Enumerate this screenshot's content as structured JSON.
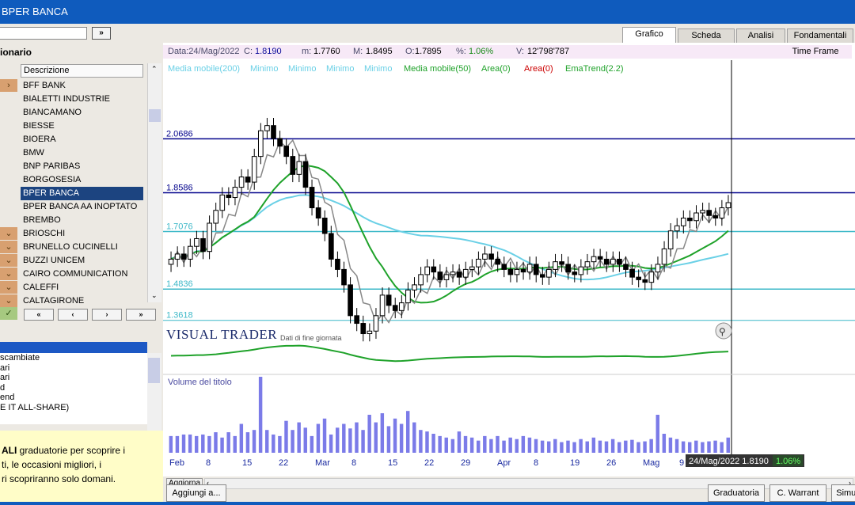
{
  "window": {
    "title": "BPER BANCA"
  },
  "left": {
    "search_value": "",
    "go_label": "»",
    "list_label": "ionario",
    "list_header": "Descrizione",
    "items": [
      {
        "label": "BFF BANK",
        "icon": "chevron-right-icon"
      },
      {
        "label": "BIALETTI INDUSTRIE",
        "icon": ""
      },
      {
        "label": "BIANCAMANO",
        "icon": ""
      },
      {
        "label": "BIESSE",
        "icon": ""
      },
      {
        "label": "BIOERA",
        "icon": ""
      },
      {
        "label": "BMW",
        "icon": ""
      },
      {
        "label": "BNP PARIBAS",
        "icon": ""
      },
      {
        "label": "BORGOSESIA",
        "icon": ""
      },
      {
        "label": "BPER BANCA",
        "icon": "",
        "selected": true
      },
      {
        "label": "BPER BANCA AA INOPTATO",
        "icon": ""
      },
      {
        "label": "BREMBO",
        "icon": ""
      },
      {
        "label": "BRIOSCHI",
        "icon": "chevron-down-icon"
      },
      {
        "label": "BRUNELLO CUCINELLI",
        "icon": "chevron-down-icon"
      },
      {
        "label": "BUZZI UNICEM",
        "icon": "chevron-down-icon"
      },
      {
        "label": "CAIRO COMMUNICATION",
        "icon": "chevron-down-icon"
      },
      {
        "label": "CALEFFI",
        "icon": "chevron-down-icon"
      },
      {
        "label": "CALTAGIRONE",
        "icon": "chevron-down-icon"
      }
    ],
    "nav": [
      "«",
      "‹",
      "›",
      "»"
    ],
    "info_lines": [
      "scambiate",
      "ari",
      "ari",
      "d",
      "end",
      "E IT ALL-SHARE)"
    ],
    "promo_bold": "ALI",
    "promo_lines": [
      " graduatorie per scoprire i",
      "ti, le occasioni migliori, i",
      "ri scopriranno solo domani."
    ]
  },
  "tabs": [
    {
      "label": "Grafico",
      "active": true
    },
    {
      "label": "Scheda",
      "active": false
    },
    {
      "label": "Analisi",
      "active": false
    },
    {
      "label": "Fondamentali",
      "active": false
    }
  ],
  "databar": {
    "date": "Data:24/Mag/2022",
    "close_label": "C:",
    "close": "1.8190",
    "min_label": "m:",
    "min": "1.7760",
    "max_label": "M:",
    "max": "1.8495",
    "open_label": "O:",
    "open": "1.7895",
    "pct_label": "%:",
    "pct": "1.06%",
    "vol_label": "V:",
    "vol": "12'798'787",
    "timeframe": "Time Frame"
  },
  "legend": [
    {
      "label": "Media mobile(200)",
      "color": "#6ad0e6"
    },
    {
      "label": "Minimo",
      "color": "#6ad0e6"
    },
    {
      "label": "Minimo",
      "color": "#6ad0e6"
    },
    {
      "label": "Minimo",
      "color": "#6ad0e6"
    },
    {
      "label": "Minimo",
      "color": "#6ad0e6"
    },
    {
      "label": "Media mobile(50)",
      "color": "#1fa22a"
    },
    {
      "label": "Area(0)",
      "color": "#1fa22a"
    },
    {
      "label": "Area(0)",
      "color": "#cc0000"
    },
    {
      "label": "EmaTrend(2.2)",
      "color": "#1fa22a"
    }
  ],
  "levels": [
    "2.0686",
    "1.8586",
    "1.7076",
    "1.4836",
    "1.3618"
  ],
  "brand": "VISUAL TRADER",
  "brand_sub": "Dati di fine giornata",
  "volume_label": "Volume del titolo",
  "x_labels": [
    "Feb",
    "8",
    "15",
    "22",
    "Mar",
    "8",
    "15",
    "22",
    "29",
    "Apr",
    "8",
    "19",
    "26",
    "Mag",
    "9"
  ],
  "cursor_tag": {
    "text": "24/Mag/2022 1.8190",
    "pct": "1.06%"
  },
  "buttons": {
    "aggiorna": "Aggiorna",
    "aggiungi": "Aggiungi a...",
    "graduatoria": "Graduatoria",
    "cwarrant": "C. Warrant",
    "simul": "Simul"
  },
  "chart_data": {
    "type": "candlestick",
    "closes": [
      1.6,
      1.62,
      1.6,
      1.65,
      1.68,
      1.63,
      1.74,
      1.79,
      1.85,
      1.84,
      1.88,
      1.92,
      1.9,
      2.0,
      2.1,
      2.12,
      2.07,
      2.04,
      2.0,
      1.93,
      1.98,
      1.88,
      1.8,
      1.76,
      1.7,
      1.6,
      1.56,
      1.5,
      1.38,
      1.35,
      1.31,
      1.32,
      1.38,
      1.46,
      1.42,
      1.4,
      1.43,
      1.48,
      1.5,
      1.54,
      1.57,
      1.55,
      1.52,
      1.54,
      1.55,
      1.53,
      1.56,
      1.57,
      1.6,
      1.62,
      1.6,
      1.58,
      1.56,
      1.54,
      1.56,
      1.55,
      1.58,
      1.54,
      1.53,
      1.56,
      1.59,
      1.58,
      1.55,
      1.54,
      1.57,
      1.59,
      1.61,
      1.6,
      1.58,
      1.6,
      1.58,
      1.56,
      1.53,
      1.52,
      1.51,
      1.55,
      1.58,
      1.64,
      1.71,
      1.73,
      1.76,
      1.75,
      1.78,
      1.79,
      1.77,
      1.76,
      1.8,
      1.82
    ],
    "volume": [
      0.22,
      0.22,
      0.24,
      0.24,
      0.22,
      0.24,
      0.22,
      0.27,
      0.2,
      0.27,
      0.22,
      0.38,
      0.27,
      0.3,
      1.0,
      0.3,
      0.24,
      0.22,
      0.42,
      0.3,
      0.4,
      0.33,
      0.22,
      0.38,
      0.45,
      0.24,
      0.33,
      0.38,
      0.32,
      0.4,
      0.3,
      0.5,
      0.4,
      0.52,
      0.35,
      0.45,
      0.38,
      0.55,
      0.4,
      0.3,
      0.28,
      0.25,
      0.22,
      0.2,
      0.18,
      0.28,
      0.22,
      0.2,
      0.16,
      0.22,
      0.18,
      0.22,
      0.16,
      0.2,
      0.18,
      0.22,
      0.2,
      0.18,
      0.16,
      0.15,
      0.18,
      0.14,
      0.16,
      0.14,
      0.18,
      0.15,
      0.2,
      0.16,
      0.15,
      0.18,
      0.14,
      0.16,
      0.17,
      0.14,
      0.15,
      0.18,
      0.5,
      0.25,
      0.2,
      0.18,
      0.15,
      0.14,
      0.16,
      0.14,
      0.15,
      0.16,
      0.14,
      0.2
    ],
    "ylim": [
      1.25,
      2.25
    ]
  }
}
